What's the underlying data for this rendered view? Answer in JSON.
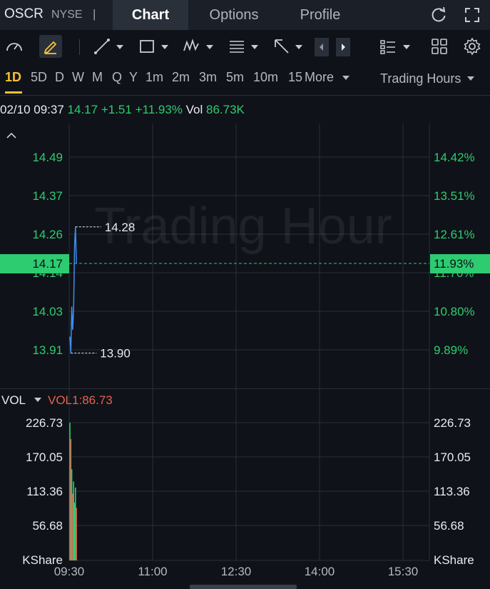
{
  "header": {
    "ticker": "OSCR",
    "exchange": "NYSE",
    "separator": "|",
    "tabs": [
      {
        "label": "Chart",
        "active": true
      },
      {
        "label": "Options",
        "active": false
      },
      {
        "label": "Profile",
        "active": false
      }
    ]
  },
  "periods": {
    "items": [
      "1D",
      "5D",
      "D",
      "W",
      "M",
      "Q",
      "Y",
      "1m",
      "2m",
      "3m",
      "5m",
      "10m",
      "15",
      "More"
    ],
    "active": "1D",
    "trading_hours": "Trading Hours"
  },
  "info": {
    "datetime": "02/10 09:37",
    "price": "14.17",
    "change": "+1.51",
    "change_pct": "+11.93%",
    "vol_label": "Vol",
    "vol_value": "86.73K"
  },
  "price_chart": {
    "watermark": "Trading Hour",
    "left_ticks": [
      "14.49",
      "14.37",
      "14.26",
      "14.14",
      "14.03",
      "13.91"
    ],
    "right_ticks": [
      "14.42%",
      "13.51%",
      "12.61%",
      "11.70%",
      "10.80%",
      "9.89%"
    ],
    "current_price": "14.17",
    "current_pct": "11.93%",
    "high_label": "14.28",
    "low_label": "13.90"
  },
  "volume_chart": {
    "label": "VOL",
    "indicator": "VOL1:86.73",
    "left_ticks": [
      "226.73",
      "170.05",
      "113.36",
      "56.68",
      "KShare"
    ],
    "right_ticks": [
      "226.73",
      "170.05",
      "113.36",
      "56.68",
      "KShare"
    ]
  },
  "time_axis": [
    "09:30",
    "11:00",
    "12:30",
    "14:00",
    "15:30"
  ],
  "colors": {
    "up": "#2ecc71",
    "accent": "#f6c231",
    "line": "#3d8ef0",
    "indicator": "#e8614f"
  },
  "chart_data": {
    "type": "line",
    "xlabel": "",
    "ylabel": "",
    "x": [
      "09:30",
      "09:31",
      "09:32",
      "09:33",
      "09:34",
      "09:35",
      "09:36",
      "09:37"
    ],
    "series": [
      {
        "values": [
          13.95,
          13.9,
          14.04,
          13.97,
          14.03,
          14.22,
          14.28,
          14.17
        ]
      }
    ],
    "volume": [
      226.73,
      200.0,
      150.0,
      110.0,
      130.0,
      95.0,
      120.0,
      86.73
    ],
    "ylim": [
      13.85,
      14.55
    ],
    "xlim": [
      "09:30",
      "16:00"
    ],
    "grid": true
  }
}
